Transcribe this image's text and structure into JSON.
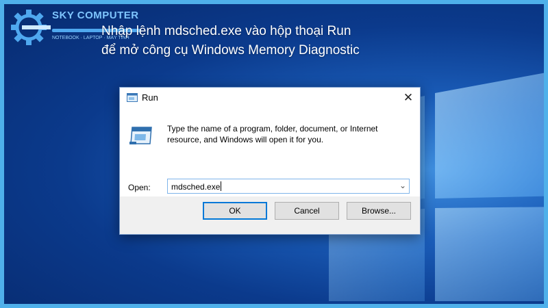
{
  "brand": {
    "name": "SKY COMPUTER",
    "tagline": "NOTEBOOK · LAPTOP · MÁY TÍNH"
  },
  "caption": {
    "line1": "Nhập lệnh mdsched.exe vào hộp thoại Run",
    "line2": "để mở công cụ Windows Memory Diagnostic"
  },
  "dialog": {
    "title": "Run",
    "close_glyph": "✕",
    "description": "Type the name of a program, folder, document, or Internet resource, and Windows will open it for you.",
    "open_label": "Open:",
    "open_value": "mdsched.exe",
    "dropdown_glyph": "⌄",
    "buttons": {
      "ok": "OK",
      "cancel": "Cancel",
      "browse": "Browse..."
    }
  },
  "colors": {
    "accent": "#0078d7",
    "frame": "#4fb0ea",
    "desktop": "#0b3a8c"
  },
  "icons": {
    "title": "run-icon",
    "big": "run-program-icon",
    "close": "close-icon",
    "dropdown": "chevron-down-icon",
    "logo": "gear-wrench-icon"
  }
}
